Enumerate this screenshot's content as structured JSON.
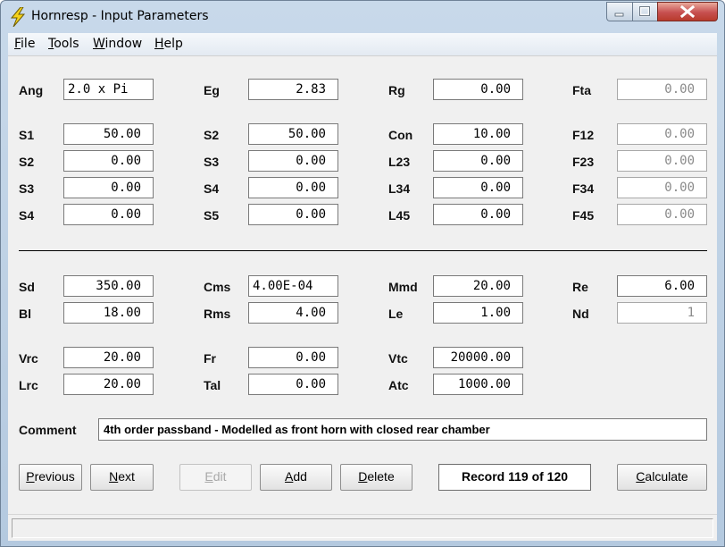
{
  "window": {
    "title": "Hornresp - Input Parameters"
  },
  "menu": [
    {
      "hot": "F",
      "rest": "ile"
    },
    {
      "hot": "T",
      "rest": "ools"
    },
    {
      "hot": "W",
      "rest": "indow"
    },
    {
      "hot": "H",
      "rest": "elp"
    }
  ],
  "params": {
    "ang": {
      "label": "Ang",
      "value": "2.0 x Pi"
    },
    "eg": {
      "label": "Eg",
      "value": "2.83"
    },
    "rg": {
      "label": "Rg",
      "value": "0.00"
    },
    "fta": {
      "label": "Fta",
      "value": "0.00"
    },
    "s1": {
      "label": "S1",
      "value": "50.00"
    },
    "s2b": {
      "label": "S2",
      "value": "50.00"
    },
    "con": {
      "label": "Con",
      "value": "10.00"
    },
    "f12": {
      "label": "F12",
      "value": "0.00"
    },
    "s2": {
      "label": "S2",
      "value": "0.00"
    },
    "s3b": {
      "label": "S3",
      "value": "0.00"
    },
    "l23": {
      "label": "L23",
      "value": "0.00"
    },
    "f23": {
      "label": "F23",
      "value": "0.00"
    },
    "s3": {
      "label": "S3",
      "value": "0.00"
    },
    "s4b": {
      "label": "S4",
      "value": "0.00"
    },
    "l34": {
      "label": "L34",
      "value": "0.00"
    },
    "f34": {
      "label": "F34",
      "value": "0.00"
    },
    "s4": {
      "label": "S4",
      "value": "0.00"
    },
    "s5": {
      "label": "S5",
      "value": "0.00"
    },
    "l45": {
      "label": "L45",
      "value": "0.00"
    },
    "f45": {
      "label": "F45",
      "value": "0.00"
    },
    "sd": {
      "label": "Sd",
      "value": "350.00"
    },
    "cms": {
      "label": "Cms",
      "value": "4.00E-04"
    },
    "mmd": {
      "label": "Mmd",
      "value": "20.00"
    },
    "re": {
      "label": "Re",
      "value": "6.00"
    },
    "bl": {
      "label": "Bl",
      "value": "18.00"
    },
    "rms": {
      "label": "Rms",
      "value": "4.00"
    },
    "le": {
      "label": "Le",
      "value": "1.00"
    },
    "nd": {
      "label": "Nd",
      "value": "1"
    },
    "vrc": {
      "label": "Vrc",
      "value": "20.00"
    },
    "fr": {
      "label": "Fr",
      "value": "0.00"
    },
    "vtc": {
      "label": "Vtc",
      "value": "20000.00"
    },
    "lrc": {
      "label": "Lrc",
      "value": "20.00"
    },
    "tal": {
      "label": "Tal",
      "value": "0.00"
    },
    "atc": {
      "label": "Atc",
      "value": "1000.00"
    }
  },
  "comment": {
    "label": "Comment",
    "value": "4th order passband - Modelled as front horn with closed rear chamber"
  },
  "buttons": {
    "previous": {
      "hot": "P",
      "rest": "revious"
    },
    "next": {
      "hot": "N",
      "rest": "ext"
    },
    "edit": {
      "hot": "E",
      "rest": "dit"
    },
    "add": {
      "hot": "A",
      "rest": "dd"
    },
    "delete": {
      "hot": "D",
      "rest": "elete"
    },
    "calculate": {
      "hot": "C",
      "rest": "alculate"
    }
  },
  "record": "Record 119 of 120",
  "colors": {
    "disabled_text": "#8a8a8a",
    "close_button": "#c75050",
    "window_frame": "#b4c9df"
  }
}
